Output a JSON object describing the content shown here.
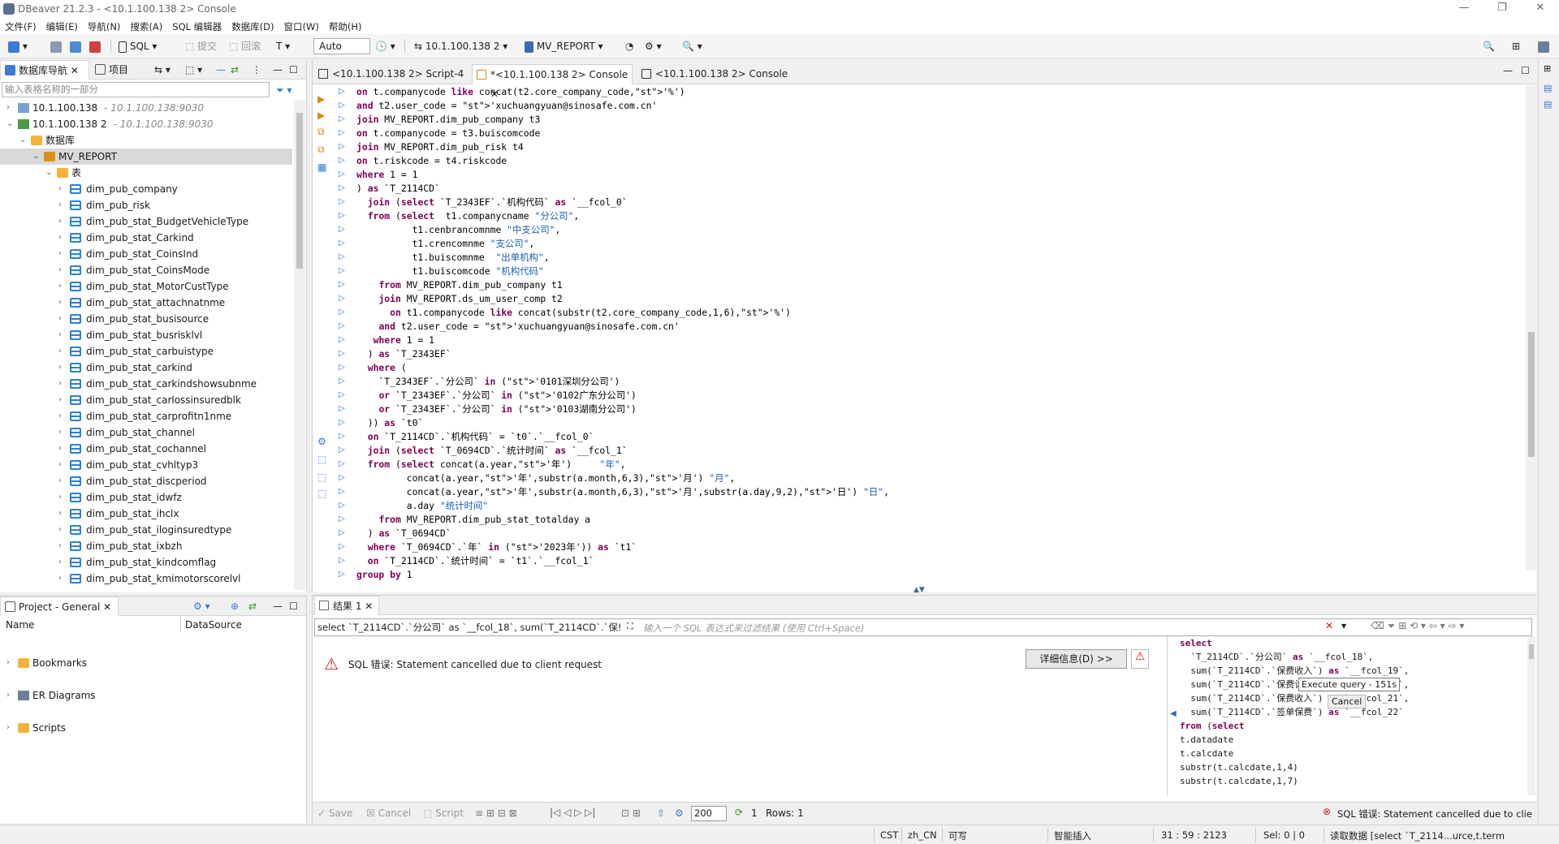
{
  "window": {
    "title": "DBeaver 21.2.3 - <10.1.100.138 2> Console"
  },
  "menu": [
    "文件(F)",
    "编辑(E)",
    "导航(N)",
    "搜索(A)",
    "SQL 编辑器",
    "数据库(D)",
    "窗口(W)",
    "帮助(H)"
  ],
  "toolbar": {
    "sql_label": "SQL",
    "commit_label": "提交",
    "rollback_label": "回滚",
    "mode": "Auto",
    "connection": "10.1.100.138 2",
    "schema": "MV_REPORT"
  },
  "navigator": {
    "tab_db": "数据库导航",
    "tab_project": "项目",
    "filter_placeholder": "输入表格名称的一部分",
    "connections": [
      {
        "name": "10.1.100.138",
        "host": "- 10.1.100.138:9030"
      },
      {
        "name": "10.1.100.138 2",
        "host": "- 10.1.100.138:9030"
      }
    ],
    "databases_label": "数据库",
    "schema_label": "MV_REPORT",
    "tables_label": "表",
    "tables": [
      "dim_pub_company",
      "dim_pub_risk",
      "dim_pub_stat_BudgetVehicleType",
      "dim_pub_stat_Carkind",
      "dim_pub_stat_CoinsInd",
      "dim_pub_stat_CoinsMode",
      "dim_pub_stat_MotorCustType",
      "dim_pub_stat_attachnatnme",
      "dim_pub_stat_busisource",
      "dim_pub_stat_busrisklvl",
      "dim_pub_stat_carbuistype",
      "dim_pub_stat_carkind",
      "dim_pub_stat_carkindshowsubnme",
      "dim_pub_stat_carlossinsuredblk",
      "dim_pub_stat_carprofitn1nme",
      "dim_pub_stat_channel",
      "dim_pub_stat_cochannel",
      "dim_pub_stat_cvhltyp3",
      "dim_pub_stat_discperiod",
      "dim_pub_stat_idwfz",
      "dim_pub_stat_ihclx",
      "dim_pub_stat_iloginsuredtype",
      "dim_pub_stat_ixbzh",
      "dim_pub_stat_kindcomflag",
      "dim_pub_stat_kmimotorscorelvl"
    ]
  },
  "project": {
    "tab": "Project - General",
    "col_name": "Name",
    "col_datasource": "DataSource",
    "items": [
      "Bookmarks",
      "ER Diagrams",
      "Scripts"
    ]
  },
  "editor": {
    "tabs": [
      "<10.1.100.138 2> Script-4",
      "*<10.1.100.138 2> Console",
      "<10.1.100.138 2> Console"
    ],
    "lines": [
      "on t.companycode like concat(t2.core_company_code,'%')",
      "and t2.user_code = 'xuchuangyuan@sinosafe.com.cn'",
      "join MV_REPORT.dim_pub_company t3",
      "on t.companycode = t3.buiscomcode",
      "join MV_REPORT.dim_pub_risk t4",
      "on t.riskcode = t4.riskcode",
      "where 1 = 1",
      ") as `T_2114CD`",
      "  join (select `T_2343EF`.`机构代码` as `__fcol_0`",
      "  from (select  t1.companycname \"分公司\",",
      "          t1.cenbrancomnme \"中支公司\",",
      "          t1.crencomnme \"支公司\",",
      "          t1.buiscomnme  \"出单机构\",",
      "          t1.buiscomcode \"机构代码\"",
      "    from MV_REPORT.dim_pub_company t1",
      "    join MV_REPORT.ds_um_user_comp t2",
      "      on t1.companycode like concat(substr(t2.core_company_code,1,6),'%')",
      "    and t2.user_code = 'xuchuangyuan@sinosafe.com.cn'",
      "   where 1 = 1",
      "  ) as `T_2343EF`",
      "  where (",
      "    `T_2343EF`.`分公司` in ('0101深圳分公司')",
      "    or `T_2343EF`.`分公司` in ('0102广东分公司')",
      "    or `T_2343EF`.`分公司` in ('0103湖南分公司')",
      "  )) as `t0`",
      "  on `T_2114CD`.`机构代码` = `t0`.`__fcol_0`",
      "  join (select `T_0694CD`.`统计时间` as `__fcol_1`",
      "  from (select concat(a.year,'年')     \"年\",",
      "         concat(a.year,'年',substr(a.month,6,3),'月') \"月\",",
      "         concat(a.year,'年',substr(a.month,6,3),'月',substr(a.day,9,2),'日') \"日\",",
      "         a.day \"统计时间\"",
      "    from MV_REPORT.dim_pub_stat_totalday a",
      "  ) as `T_0694CD`",
      "  where `T_0694CD`.`年` in ('2023年')) as `t1`",
      "  on `T_2114CD`.`统计时间` = `t1`.`__fcol_1`",
      "group by 1"
    ]
  },
  "results": {
    "tab": "结果 1",
    "sql_preview": "select `T_2114CD`.`分公司` as `__fcol_18`, sum(`T_2114CD`.`保!",
    "filter_placeholder": "输入一个 SQL 表达式来过滤结果 (使用 Ctrl+Space)",
    "error_text": "SQL 错误: Statement cancelled due to client request",
    "details_button": "详细信息(D) >>",
    "tooltip_text": "Execute query - 151s",
    "cancel_label": "Cancel",
    "side_sql": [
      "select",
      "  `T_2114CD`.`分公司` as `__fcol_18`,",
      "  sum(`T_2114CD`.`保费收入`) as `__fcol_19`,",
      "  sum(`T_2114CD`.`保费计划`) as `__fcol_20`,",
      "  sum(`T_2114CD`.`保费收入`) as `__fcol_21`,",
      "  sum(`T_2114CD`.`签单保费`) as `__fcol_22`",
      "from (select",
      "t.datadate",
      "t.calcdate",
      "substr(t.calcdate,1,4)",
      "substr(t.calcdate,1,7)"
    ],
    "bottom": {
      "save": "Save",
      "cancel": "Cancel",
      "script": "Script",
      "fetch_size": "200",
      "count": "1",
      "rows": "Rows: 1",
      "status_error": "SQL 错误: Statement cancelled due to clie"
    }
  },
  "statusbar": {
    "cst": "CST",
    "locale": "zh_CN",
    "mode": "可写",
    "insert": "智能插入",
    "position": "31 : 59 : 2123",
    "sel": "Sel: 0 | 0",
    "reading": "读取数据 [select `T_2114...urce,t.term"
  }
}
